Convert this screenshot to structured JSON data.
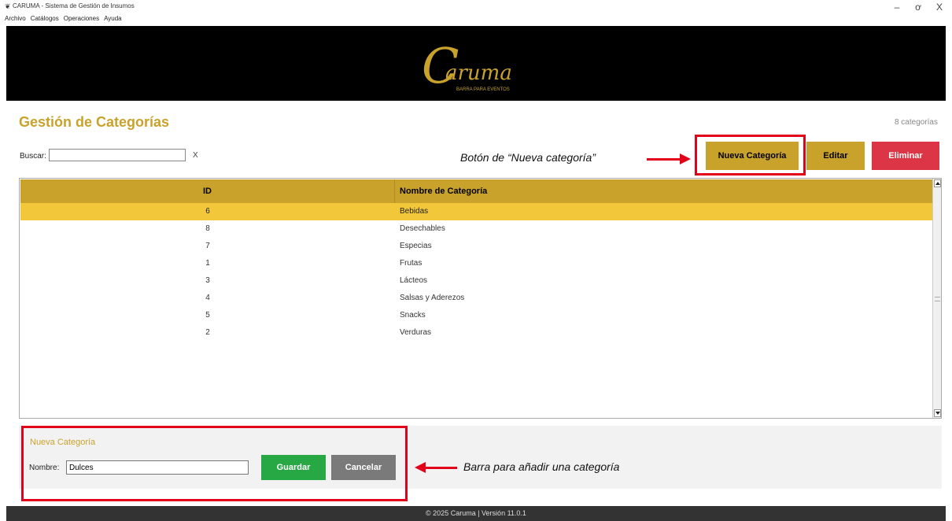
{
  "window": {
    "title": "CARUMA - Sistema de Gestión de Insumos",
    "controls": {
      "minimize": "–",
      "maximize": "ơ",
      "close": "X"
    }
  },
  "menu": [
    "Archivo",
    "Catálogos",
    "Operaciones",
    "Ayuda"
  ],
  "banner": {
    "logo_text": "aruma",
    "logo_initial": "C",
    "logo_subtitle": "BARRA PARA EVENTOS"
  },
  "page": {
    "title": "Gestión de Categorías",
    "count": "8 categorías"
  },
  "search": {
    "label": "Buscar:",
    "value": "",
    "clear_label": "X"
  },
  "toolbar": {
    "new_label": "Nueva Categoría",
    "edit_label": "Editar",
    "delete_label": "Eliminar"
  },
  "table": {
    "columns": [
      "ID",
      "Nombre de Categoría"
    ],
    "rows": [
      {
        "id": "6",
        "name": "Bebidas",
        "selected": true
      },
      {
        "id": "8",
        "name": "Desechables"
      },
      {
        "id": "7",
        "name": "Especias"
      },
      {
        "id": "1",
        "name": "Frutas"
      },
      {
        "id": "3",
        "name": "Lácteos"
      },
      {
        "id": "4",
        "name": "Salsas y Aderezos"
      },
      {
        "id": "5",
        "name": "Snacks"
      },
      {
        "id": "2",
        "name": "Verduras"
      }
    ]
  },
  "form": {
    "title": "Nueva Categoría",
    "name_label": "Nombre:",
    "name_value": "Dulces",
    "save_label": "Guardar",
    "cancel_label": "Cancelar"
  },
  "annotations": {
    "new_button": "Botón de “Nueva categoría”",
    "add_bar": "Barra para añadir una categoría"
  },
  "footer": {
    "text": "© 2025 Caruma | Versión 11.0.1"
  },
  "colors": {
    "accent_gold": "#c9a22c",
    "selected_row": "#f2c83a",
    "danger": "#dc3545",
    "success": "#28a745",
    "annotation_red": "#e3001b"
  }
}
